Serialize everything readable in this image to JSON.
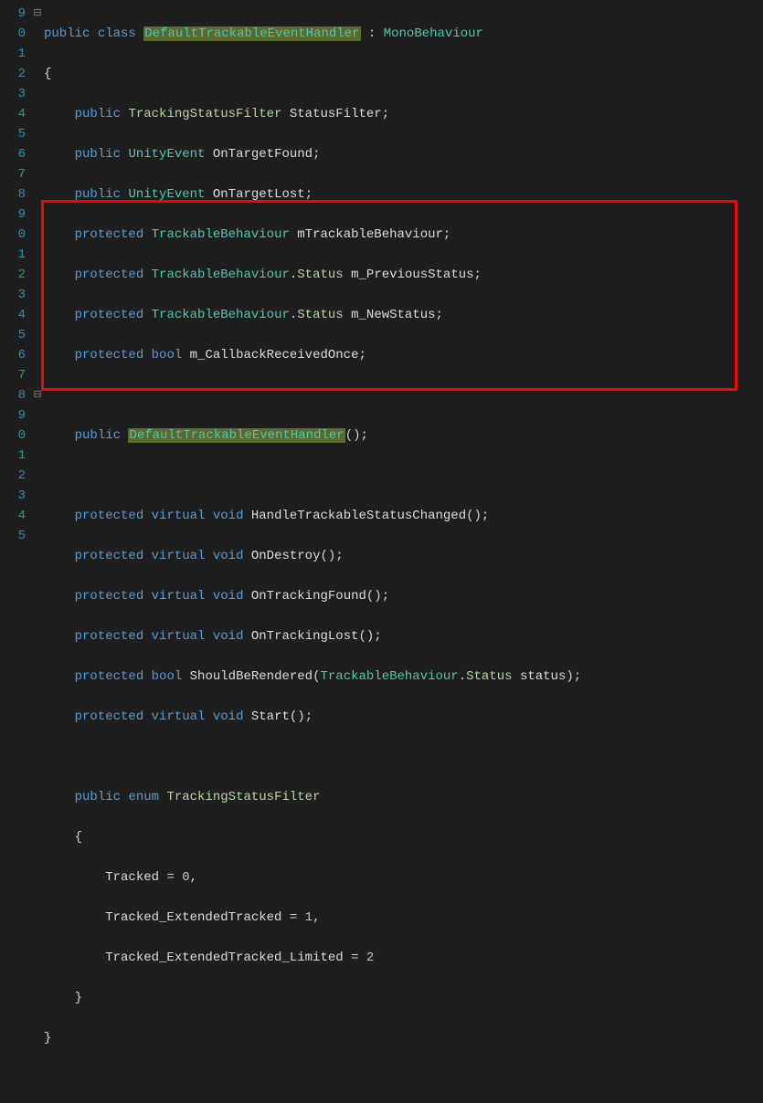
{
  "gutter": [
    "9",
    "0",
    "1",
    "2",
    "3",
    "4",
    "5",
    "6",
    "7",
    "8",
    "9",
    "0",
    "1",
    "2",
    "3",
    "4",
    "5",
    "6",
    "7",
    "8",
    "9",
    "0",
    "1",
    "2",
    "3",
    "4",
    "5"
  ],
  "fold": [
    "⊟",
    "",
    "",
    "",
    "",
    "",
    "",
    "",
    "",
    "",
    "",
    "",
    "",
    "",
    "",
    "",
    "",
    "",
    "",
    "⊟",
    "",
    "",
    "",
    "",
    "",
    "",
    ""
  ],
  "tokens": {
    "public": "public",
    "class": "class",
    "protected": "protected",
    "virtual": "virtual",
    "void": "void",
    "bool": "bool",
    "enum": "enum",
    "DefaultTrackableEventHandler": "DefaultTrackableEventHandler",
    "MonoBehaviour": "MonoBehaviour",
    "TrackingStatusFilter": "TrackingStatusFilter",
    "UnityEvent": "UnityEvent",
    "TrackableBehaviour": "TrackableBehaviour",
    "Status": "Status",
    "StatusFilter": "StatusFilter",
    "OnTargetFound": "OnTargetFound",
    "OnTargetLost": "OnTargetLost",
    "mTrackableBehaviour": "mTrackableBehaviour",
    "m_PreviousStatus": "m_PreviousStatus",
    "m_NewStatus": "m_NewStatus",
    "m_CallbackReceivedOnce": "m_CallbackReceivedOnce",
    "HandleTrackableStatusChanged": "HandleTrackableStatusChanged",
    "OnDestroy": "OnDestroy",
    "OnTrackingFound": "OnTrackingFound",
    "OnTrackingLost": "OnTrackingLost",
    "ShouldBeRendered": "ShouldBeRendered",
    "status": "status",
    "Start": "Start",
    "Tracked": "Tracked",
    "Tracked_ExtendedTracked": "Tracked_ExtendedTracked",
    "Tracked_ExtendedTracked_Limited": "Tracked_ExtendedTracked_Limited",
    "zero": "0",
    "one": "1",
    "two": "2"
  }
}
